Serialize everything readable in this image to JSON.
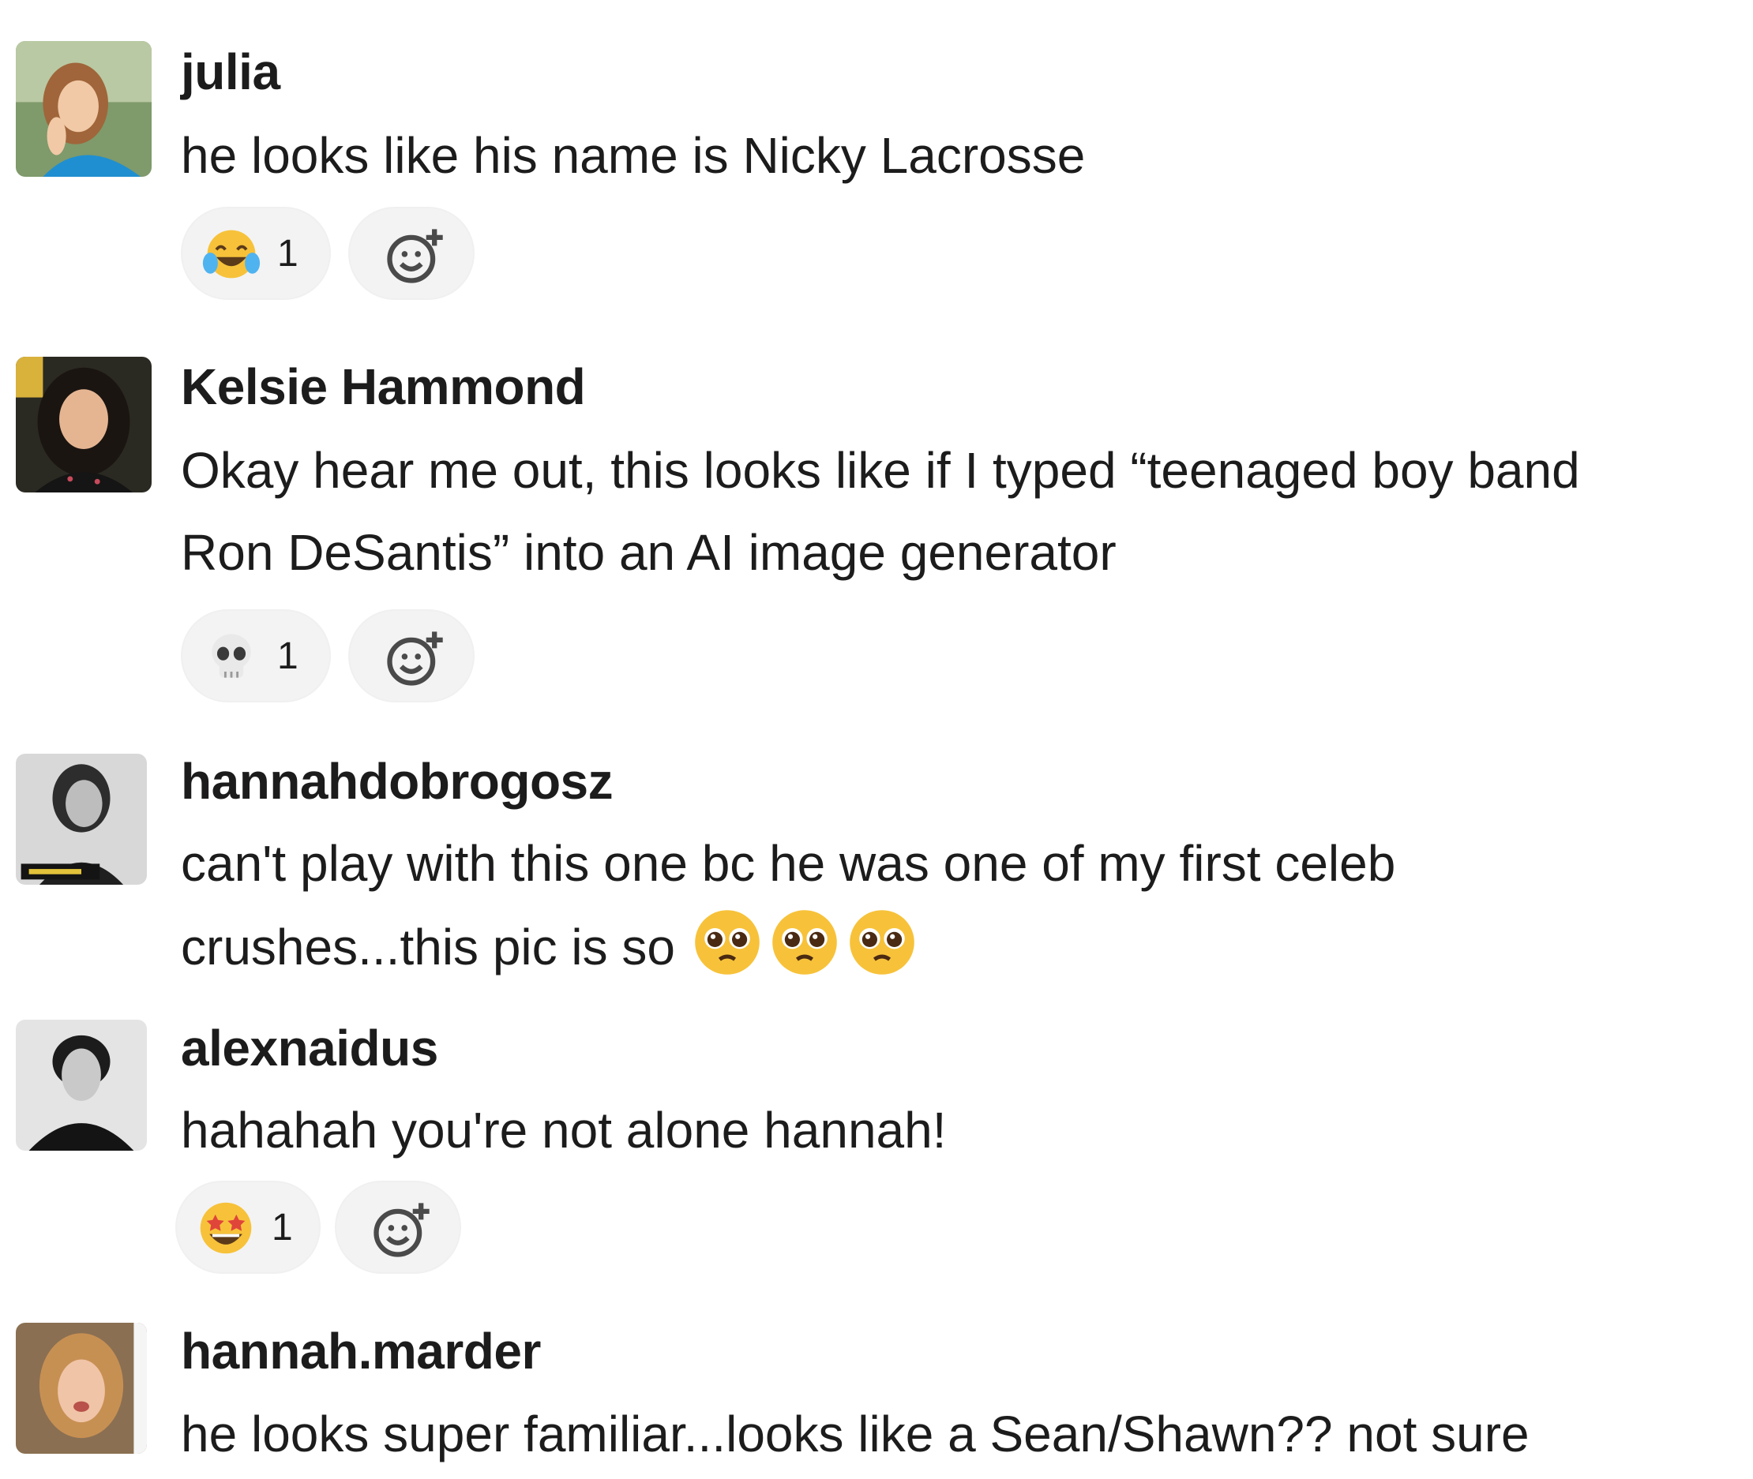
{
  "messages": [
    {
      "author": "julia",
      "lines": [
        "he looks like his name is Nicky Lacrosse"
      ],
      "reaction": {
        "emoji_name": "joy-emoji",
        "count": "1"
      }
    },
    {
      "author": "Kelsie Hammond",
      "lines": [
        "Okay hear me out, this looks like if I typed “teenaged boy band",
        "Ron DeSantis” into an AI image generator"
      ],
      "reaction": {
        "emoji_name": "skull-emoji",
        "count": "1"
      }
    },
    {
      "author": "hannahdobrogosz",
      "lines": [
        "can't play with this one bc he was one of my first celeb",
        "crushes...this pic is so"
      ],
      "inline_emoji": [
        "pleading-face-emoji",
        "pleading-face-emoji",
        "pleading-face-emoji"
      ]
    },
    {
      "author": "alexnaidus",
      "lines": [
        "hahahah you're not alone hannah!"
      ],
      "reaction": {
        "emoji_name": "star-struck-emoji",
        "count": "1"
      }
    },
    {
      "author": "hannah.marder",
      "lines": [
        "he looks super familiar...looks like a Sean/Shawn?? not sure"
      ]
    }
  ],
  "colors": {
    "text": "#1d1c1d",
    "reaction_bg": "#f3f3f3",
    "emoji_yellow": "#f7c23a"
  }
}
